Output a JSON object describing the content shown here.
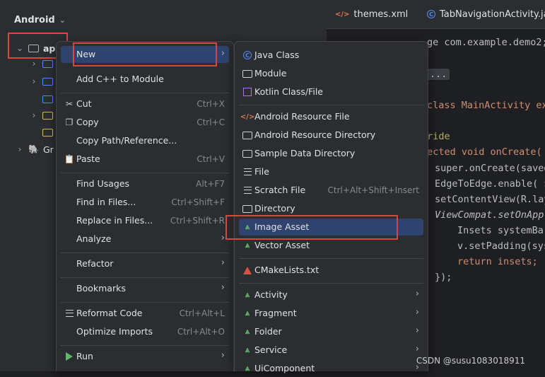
{
  "panel": {
    "title": "Android",
    "tree": {
      "app_label": "ap",
      "gradle_label": "Gr"
    }
  },
  "editor": {
    "tabs": [
      {
        "label": "themes.xml"
      },
      {
        "label": "TabNavigationActivity.java"
      }
    ],
    "lines": {
      "l1": "ge com.example.demo2;",
      "l2": "...",
      "l3": "class MainActivity ex",
      "l4": "rride",
      "l5": "tected void onCreate(",
      "l6a": "super.onCreate(saved",
      "l6": "EdgeToEdge.enable( $",
      "l7": "setContentView(R.lay",
      "l8": "ViewCompat.setOnAppl",
      "l9": "Insets systemBar",
      "l10": "v.setPadding(sys",
      "l11": "return insets;",
      "l12": "});"
    }
  },
  "menu_main": {
    "items": [
      {
        "label": "New",
        "shortcut": "",
        "icon": ""
      },
      {
        "label": "Add C++ to Module",
        "shortcut": "",
        "icon": ""
      },
      {
        "label": "Cut",
        "shortcut": "Ctrl+X",
        "icon": "scissors-icon"
      },
      {
        "label": "Copy",
        "shortcut": "Ctrl+C",
        "icon": "copy-icon"
      },
      {
        "label": "Copy Path/Reference...",
        "shortcut": "",
        "icon": ""
      },
      {
        "label": "Paste",
        "shortcut": "Ctrl+V",
        "icon": "paste-icon"
      },
      {
        "label": "Find Usages",
        "shortcut": "Alt+F7",
        "icon": ""
      },
      {
        "label": "Find in Files...",
        "shortcut": "Ctrl+Shift+F",
        "icon": ""
      },
      {
        "label": "Replace in Files...",
        "shortcut": "Ctrl+Shift+R",
        "icon": ""
      },
      {
        "label": "Analyze",
        "shortcut": "",
        "icon": ""
      },
      {
        "label": "Refactor",
        "shortcut": "",
        "icon": ""
      },
      {
        "label": "Bookmarks",
        "shortcut": "",
        "icon": ""
      },
      {
        "label": "Reformat Code",
        "shortcut": "Ctrl+Alt+L",
        "icon": "reformat-icon"
      },
      {
        "label": "Optimize Imports",
        "shortcut": "Ctrl+Alt+O",
        "icon": ""
      },
      {
        "label": "Run",
        "shortcut": "",
        "icon": "run-icon"
      }
    ]
  },
  "menu_new": {
    "items": [
      {
        "label": "Java Class",
        "shortcut": ""
      },
      {
        "label": "Module",
        "shortcut": ""
      },
      {
        "label": "Kotlin Class/File",
        "shortcut": ""
      },
      {
        "label": "Android Resource File",
        "shortcut": ""
      },
      {
        "label": "Android Resource Directory",
        "shortcut": ""
      },
      {
        "label": "Sample Data Directory",
        "shortcut": ""
      },
      {
        "label": "File",
        "shortcut": ""
      },
      {
        "label": "Scratch File",
        "shortcut": "Ctrl+Alt+Shift+Insert"
      },
      {
        "label": "Directory",
        "shortcut": ""
      },
      {
        "label": "Image Asset",
        "shortcut": ""
      },
      {
        "label": "Vector Asset",
        "shortcut": ""
      },
      {
        "label": "CMakeLists.txt",
        "shortcut": ""
      },
      {
        "label": "Activity",
        "shortcut": ""
      },
      {
        "label": "Fragment",
        "shortcut": ""
      },
      {
        "label": "Folder",
        "shortcut": ""
      },
      {
        "label": "Service",
        "shortcut": ""
      },
      {
        "label": "UiComponent",
        "shortcut": ""
      }
    ]
  },
  "watermark": "CSDN @susu1083018911",
  "colors": {
    "selection": "#2e436e",
    "highlight_box": "#e0443e"
  }
}
